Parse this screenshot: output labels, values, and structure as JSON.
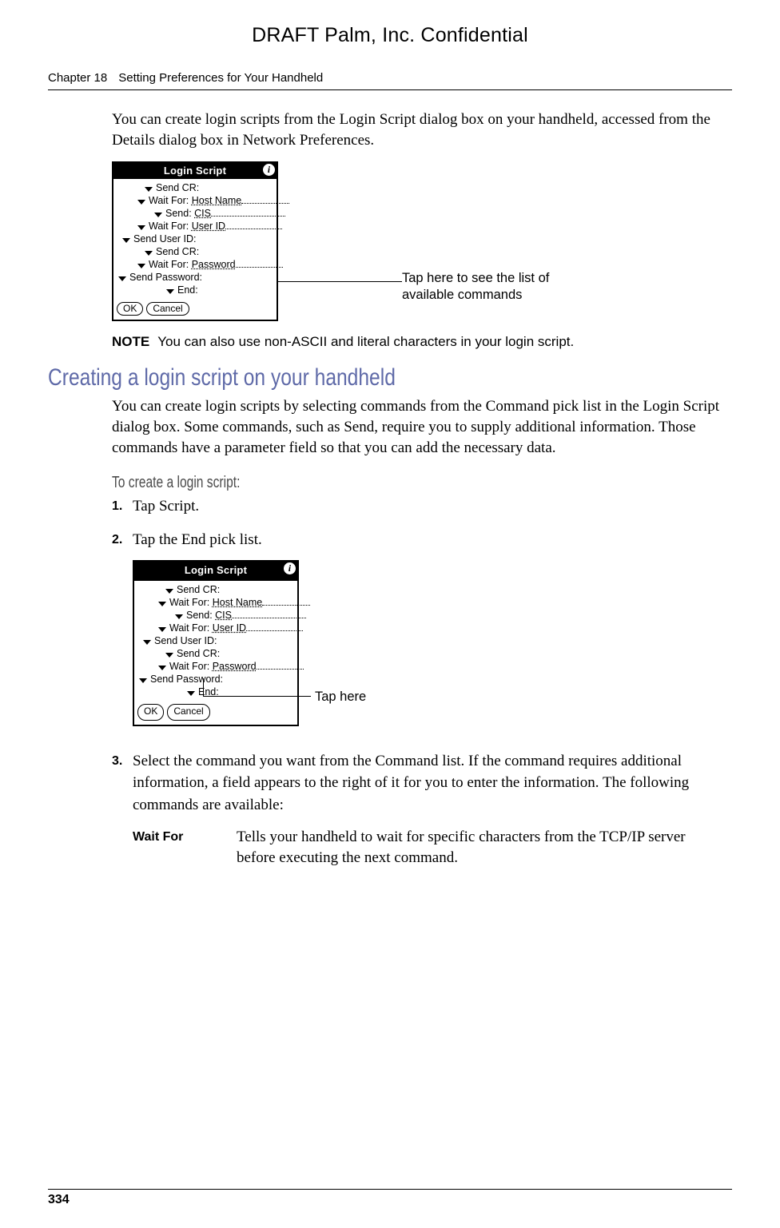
{
  "draft_header": "DRAFT   Palm, Inc. Confidential",
  "running_head": {
    "chapter": "Chapter 18",
    "title": "Setting Preferences for Your Handheld"
  },
  "intro_paragraph": "You can create login scripts from the Login Script dialog box on your handheld, accessed from the Details dialog box in Network Preferences.",
  "login_dialog": {
    "title": "Login Script",
    "lines": [
      {
        "indent": 33,
        "label": "Send CR:",
        "field": null
      },
      {
        "indent": 24,
        "label": "Wait For:",
        "field": "Host Name",
        "dots_width": 60
      },
      {
        "indent": 45,
        "label": "Send:",
        "field": "CIS",
        "dots_width": 93
      },
      {
        "indent": 24,
        "label": "Wait For:",
        "field": "User ID",
        "dots_width": 71
      },
      {
        "indent": 5,
        "label": "Send User ID:",
        "field": null
      },
      {
        "indent": 33,
        "label": "Send CR:",
        "field": null
      },
      {
        "indent": 24,
        "label": "Wait For:",
        "field": "Password",
        "dots_width": 59
      },
      {
        "indent": 0,
        "label": "Send Password:",
        "field": null,
        "no_arrow": true,
        "plain_arrow": true
      },
      {
        "indent": 60,
        "label": "End:",
        "field": null
      }
    ],
    "buttons": {
      "ok": "OK",
      "cancel": "Cancel"
    }
  },
  "callout1": {
    "line1": "Tap here to see the list of",
    "line2": "available commands"
  },
  "note": {
    "label": "NOTE",
    "text": "You can also use non-ASCII and literal characters in your login script."
  },
  "section_heading": "Creating a login script on your handheld",
  "section_paragraph": "You can create login scripts by selecting commands from the Command pick list in the Login Script dialog box. Some commands, such as Send, require you to supply additional information. Those commands have a parameter field so that you can add the necessary data.",
  "runin_heading": "To create a login script:",
  "steps": {
    "s1": "Tap Script.",
    "s2": "Tap the End pick list.",
    "s3": "Select the command you want from the Command list. If the command requires additional information, a field appears to the right of it for you to enter the information. The following commands are available:"
  },
  "callout2": "Tap here",
  "definition": {
    "term": "Wait For",
    "desc": "Tells your handheld to wait for specific characters from the TCP/IP server before executing the next command."
  },
  "page_number": "334"
}
